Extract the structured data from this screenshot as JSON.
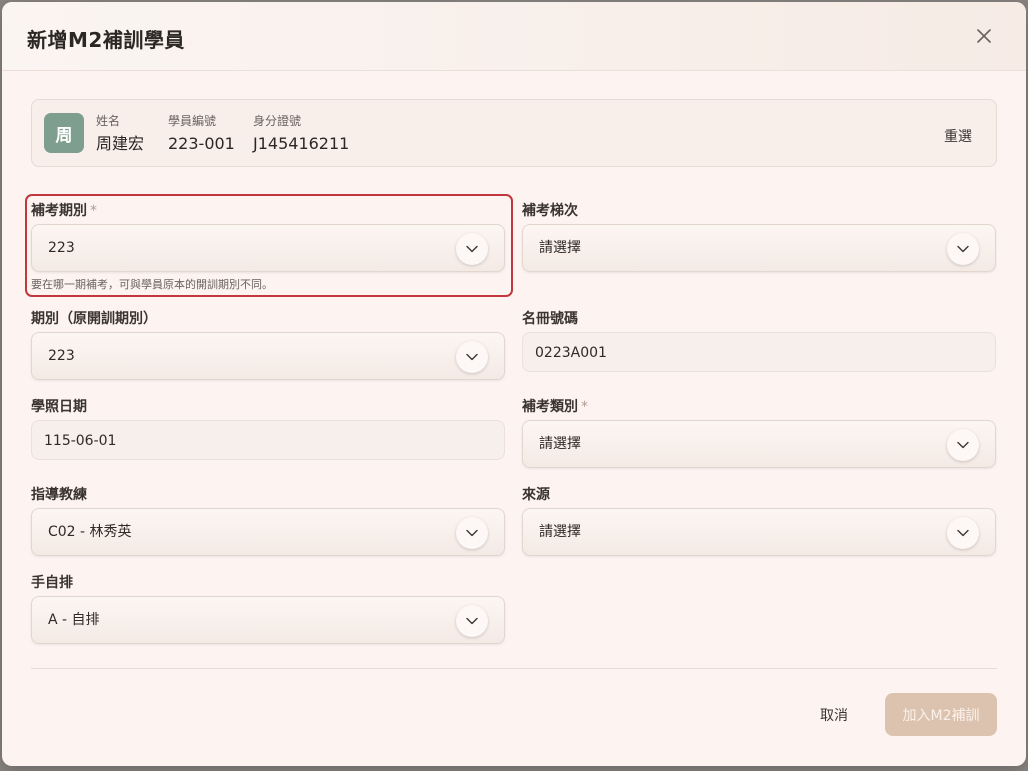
{
  "dialog": {
    "title": "新增M2補訓學員"
  },
  "student": {
    "avatar_char": "周",
    "name_label": "姓名",
    "name": "周建宏",
    "id_label": "學員編號",
    "id": "223-001",
    "national_id_label": "身分證號",
    "national_id": "J145416211",
    "reset_label": "重選"
  },
  "form": {
    "exam_period": {
      "label": "補考期別",
      "required": "*",
      "value": "223",
      "hint": "要在哪一期補考，可與學員原本的開訓期別不同。"
    },
    "exam_batch": {
      "label": "補考梯次",
      "value": "請選擇"
    },
    "orig_period": {
      "label": "期別（原開訓期別）",
      "value": "223"
    },
    "roster_no": {
      "label": "名冊號碼",
      "value": "0223A001"
    },
    "license_date": {
      "label": "學照日期",
      "value": "115-06-01"
    },
    "exam_type": {
      "label": "補考類別",
      "required": "*",
      "value": "請選擇"
    },
    "instructor": {
      "label": "指導教練",
      "value": "C02 - 林秀英"
    },
    "source": {
      "label": "來源",
      "value": "請選擇"
    },
    "manual": {
      "label": "手自排",
      "value": "A - 自排"
    }
  },
  "footer": {
    "cancel_label": "取消",
    "submit_label": "加入M2補訓"
  },
  "colors": {
    "accent_red": "#c0383e",
    "avatar_green": "#7e9e8f",
    "submit_disabled": "#dcc3b0"
  }
}
